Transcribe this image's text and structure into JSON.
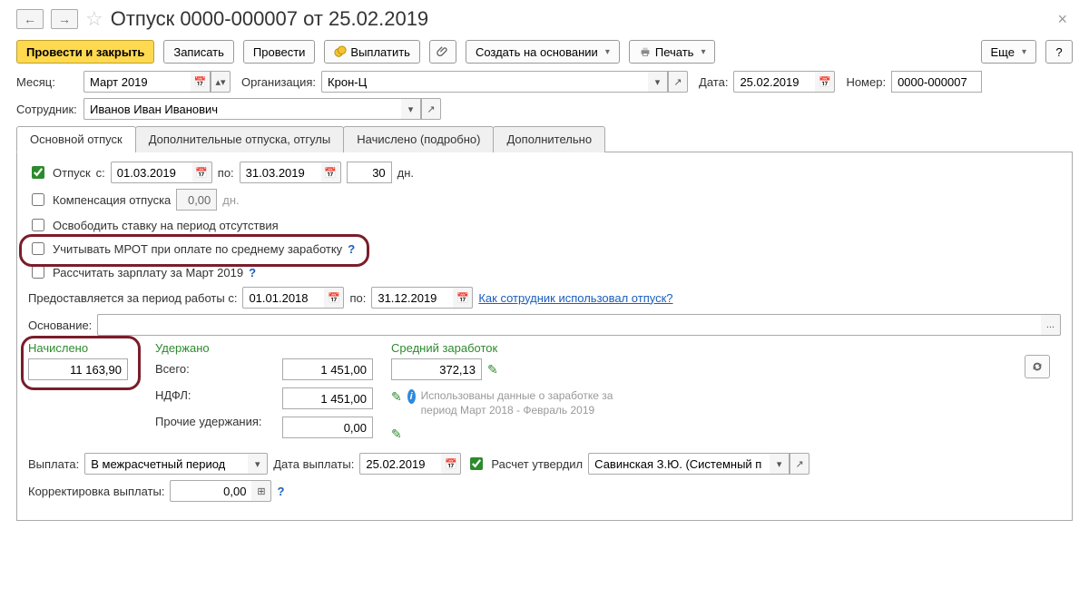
{
  "header": {
    "title": "Отпуск 0000-000007 от 25.02.2019"
  },
  "toolbar": {
    "post_close": "Провести и закрыть",
    "write": "Записать",
    "post": "Провести",
    "pay": "Выплатить",
    "base_on": "Создать на основании",
    "print": "Печать",
    "more": "Еще"
  },
  "filters": {
    "month_lbl": "Месяц:",
    "month_val": "Март 2019",
    "org_lbl": "Организация:",
    "org_val": "Крон-Ц",
    "date_lbl": "Дата:",
    "date_val": "25.02.2019",
    "num_lbl": "Номер:",
    "num_val": "0000-000007",
    "emp_lbl": "Сотрудник:",
    "emp_val": "Иванов Иван Иванович"
  },
  "tabs": {
    "t1": "Основной отпуск",
    "t2": "Дополнительные отпуска, отгулы",
    "t3": "Начислено (подробно)",
    "t4": "Дополнительно"
  },
  "main": {
    "vac_chk": "Отпуск",
    "from_lbl": "с:",
    "from_val": "01.03.2019",
    "to_lbl": "по:",
    "to_val": "31.03.2019",
    "days_val": "30",
    "days_lbl": "дн.",
    "comp_chk": "Компенсация отпуска",
    "comp_val": "0,00",
    "comp_days": "дн.",
    "free_rate": "Освободить ставку на период отсутствия",
    "mrot": "Учитывать МРОТ при оплате по среднему заработку",
    "calc_salary": "Рассчитать зарплату за Март 2019",
    "period_lbl": "Предоставляется за период работы с:",
    "period_from": "01.01.2018",
    "period_to_lbl": "по:",
    "period_to": "31.12.2019",
    "usage_link": "Как сотрудник использовал отпуск?",
    "reason_lbl": "Основание:"
  },
  "totals": {
    "accrued_hdr": "Начислено",
    "accrued_val": "11 163,90",
    "withheld_hdr": "Удержано",
    "total_lbl": "Всего:",
    "total_val": "1 451,00",
    "ndfl_lbl": "НДФЛ:",
    "ndfl_val": "1 451,00",
    "other_lbl": "Прочие удержания:",
    "other_val": "0,00",
    "avg_hdr": "Средний заработок",
    "avg_val": "372,13",
    "hint": "Использованы данные о заработке за период Март 2018 - Февраль 2019"
  },
  "footer": {
    "payout_lbl": "Выплата:",
    "payout_val": "В межрасчетный период",
    "paydate_lbl": "Дата выплаты:",
    "paydate_val": "25.02.2019",
    "approved_lbl": "Расчет утвердил",
    "approved_val": "Савинская З.Ю. (Системный п",
    "correction_lbl": "Корректировка выплаты:",
    "correction_val": "0,00"
  }
}
